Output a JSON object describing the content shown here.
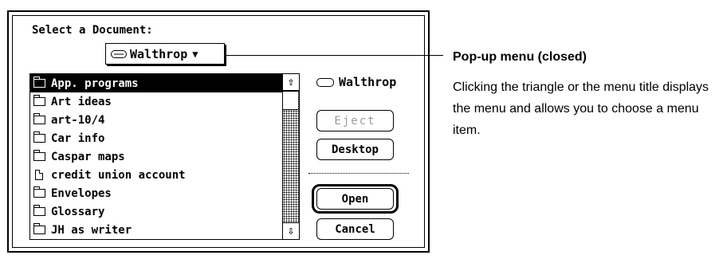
{
  "dialog": {
    "prompt": "Select a Document:",
    "popup": {
      "label": "Walthrop",
      "icon": "disk-icon"
    },
    "files": [
      {
        "name": "App. programs",
        "type": "folder",
        "selected": true
      },
      {
        "name": "Art ideas",
        "type": "folder",
        "selected": false
      },
      {
        "name": "art-10/4",
        "type": "folder",
        "selected": false
      },
      {
        "name": "Car info",
        "type": "folder",
        "selected": false
      },
      {
        "name": "Caspar maps",
        "type": "folder",
        "selected": false
      },
      {
        "name": "credit union account",
        "type": "document",
        "selected": false
      },
      {
        "name": "Envelopes",
        "type": "folder",
        "selected": false
      },
      {
        "name": "Glossary",
        "type": "folder",
        "selected": false
      },
      {
        "name": "JH as writer",
        "type": "folder",
        "selected": false
      }
    ],
    "disk_name": "Walthrop",
    "buttons": {
      "eject": "Eject",
      "desktop": "Desktop",
      "open": "Open",
      "cancel": "Cancel"
    }
  },
  "callout": {
    "title": "Pop-up menu (closed)",
    "body": "Clicking the triangle or the menu title displays the menu and allows you to choose a menu item."
  }
}
